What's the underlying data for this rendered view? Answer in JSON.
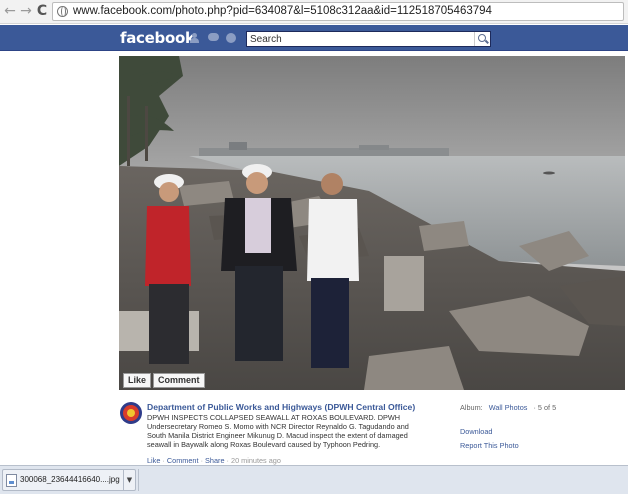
{
  "browser": {
    "back_glyph": "←",
    "forward_glyph": "→",
    "reload_glyph": "C",
    "url": "www.facebook.com/photo.php?pid=634087&l=5108c312aa&id=112518705463794"
  },
  "header": {
    "logo_text": "facebook",
    "search_placeholder": "Search",
    "brand_color": "#3b5998"
  },
  "photo": {
    "like_label": "Like",
    "comment_label": "Comment"
  },
  "caption": {
    "page_name": "Department of Public Works and Highways (DPWH Central Office)",
    "title": "DPWH INSPECTS COLLAPSED SEAWALL AT ROXAS BOULEVARD. DPWH",
    "line_1": "Undersecretary Romeo S. Momo with NCR Director Reynaldo G. Tagudando and",
    "line_2": "South Manila District Engineer Mikunug D. Macud inspect the extent of damaged",
    "line_3": "seawall in Baywalk along Roxas Boulevard caused by Typhoon Pedring.",
    "like_link": "Like",
    "comment_link": "Comment",
    "share_link": "Share",
    "separator": "·",
    "time_ago": "20 minutes ago"
  },
  "sidebar": {
    "album_label": "Album:",
    "album_name": "Wall Photos",
    "album_count": "· 5 of 5",
    "download_label": "Download",
    "report_label": "Report This Photo"
  },
  "download_shelf": {
    "file_name": "300068_23644416640....jpg",
    "dropdown_glyph": "▼"
  }
}
